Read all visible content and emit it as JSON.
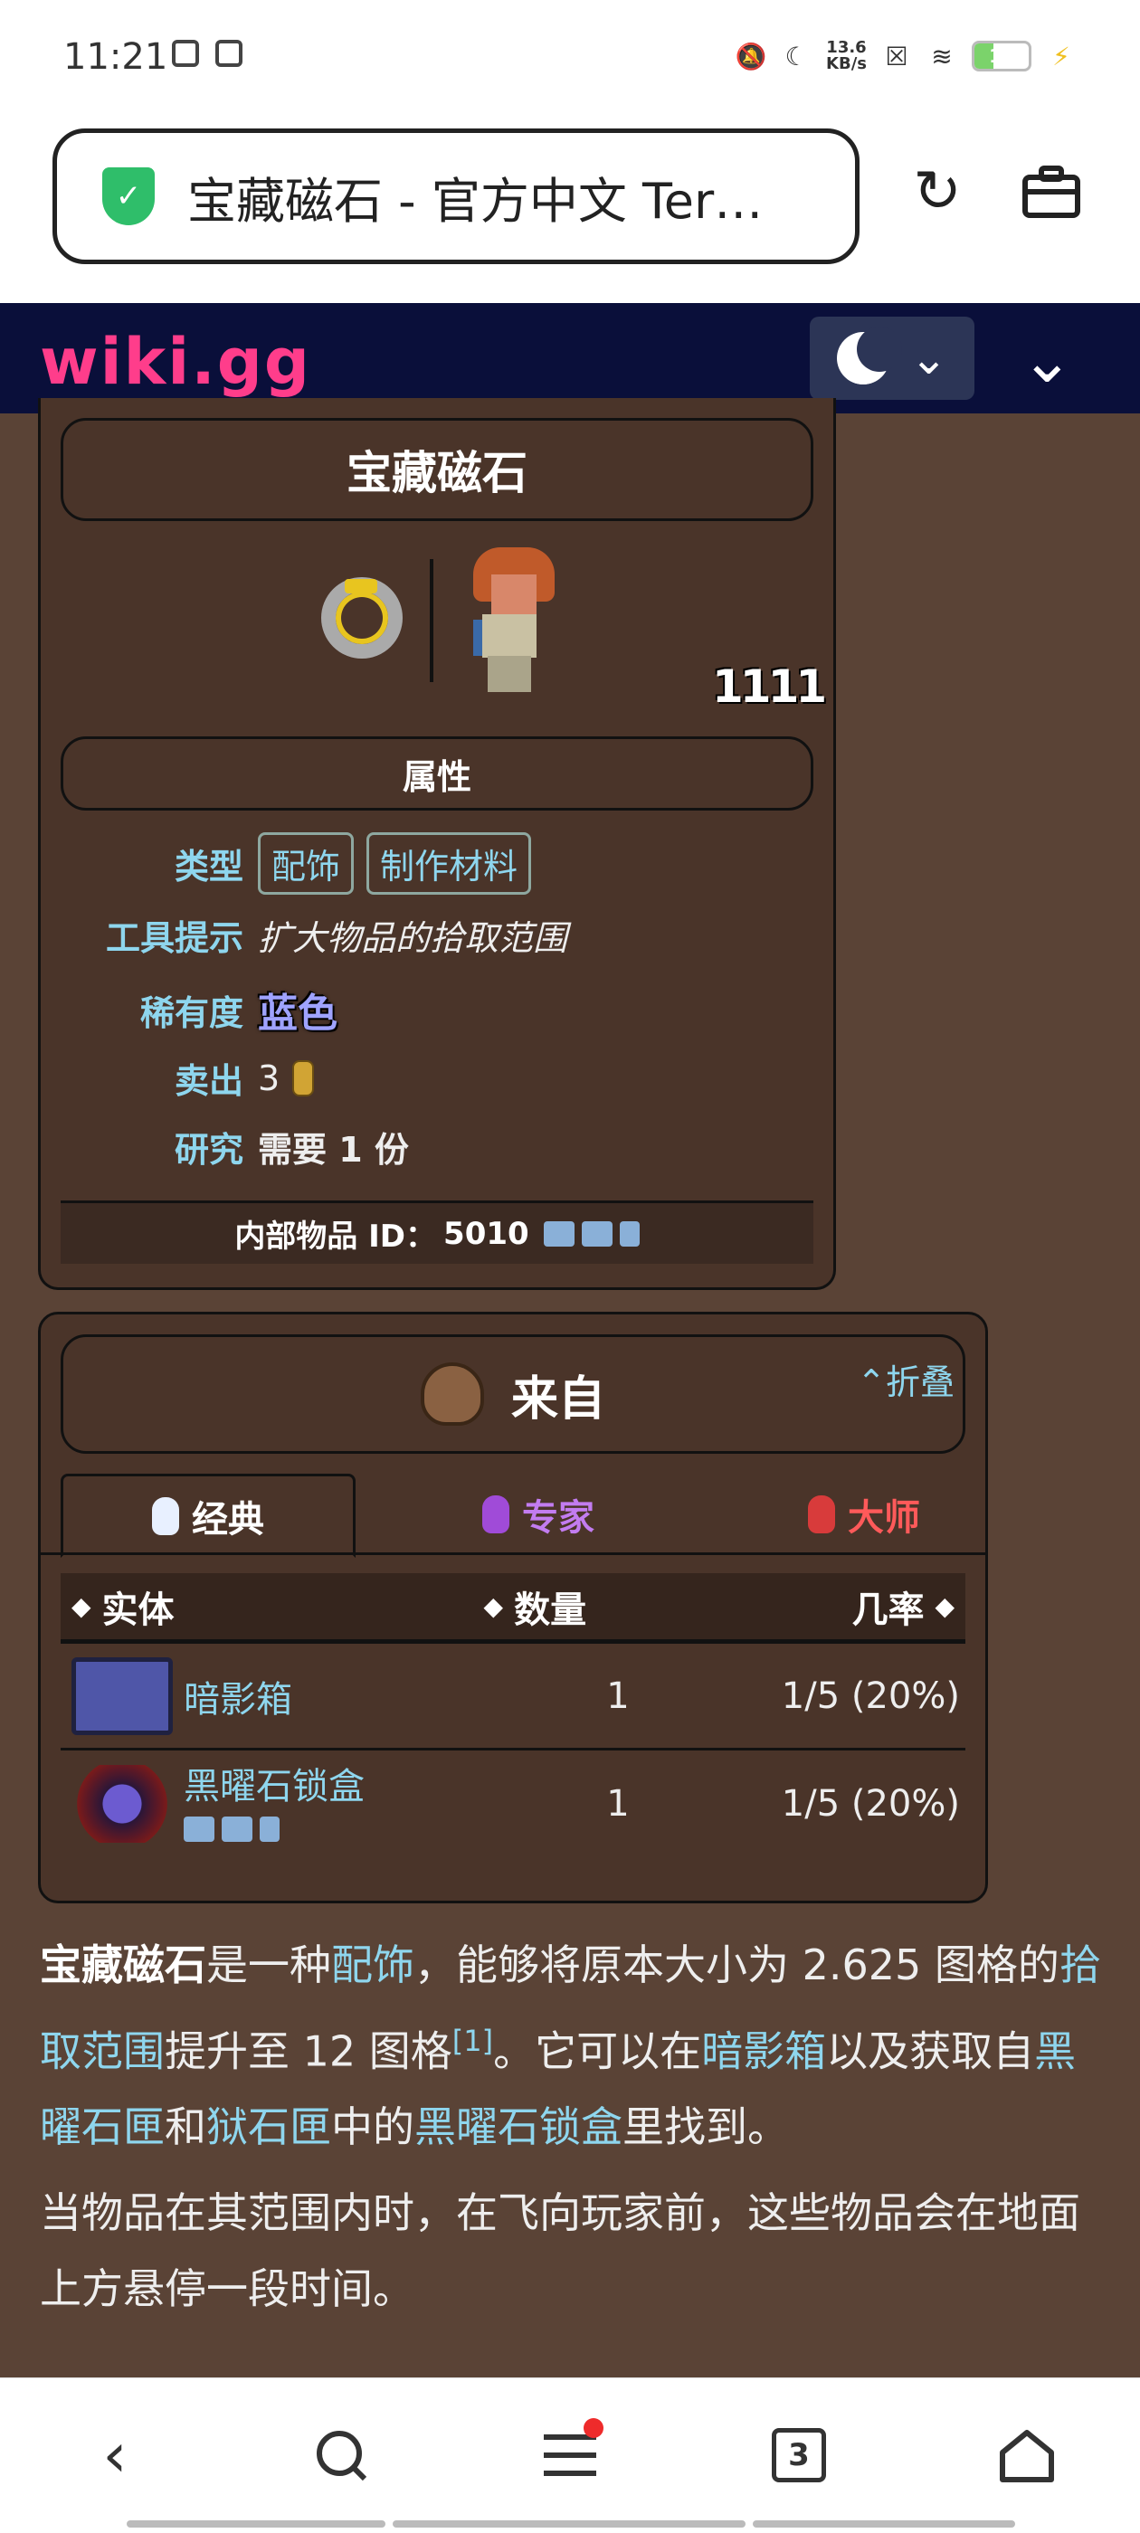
{
  "status": {
    "time": "11:21",
    "speed_top": "13.6",
    "speed_bottom": "KB/s",
    "battery": "17"
  },
  "browser": {
    "url_title": "宝藏磁石 - 官方中文 Ter…",
    "tab_count": "3"
  },
  "wiki": {
    "logo": "wiki.gg"
  },
  "infobox": {
    "title": "宝藏磁石",
    "use_time": "1111",
    "section": "属性",
    "type_label": "类型",
    "types": [
      "配饰",
      "制作材料"
    ],
    "tooltip_label": "工具提示",
    "tooltip": "扩大物品的拾取范围",
    "rarity_label": "稀有度",
    "rarity": "蓝色",
    "rarity_color": "#9fa3ff",
    "sell_label": "卖出",
    "sell": "3",
    "research_label": "研究",
    "research": "需要 1 份",
    "internal_id_label": "内部物品 ID：",
    "internal_id": "5010"
  },
  "drops": {
    "title": "来自",
    "collapse": "折叠",
    "tabs": [
      {
        "label": "经典",
        "color": "#ffffff",
        "icon": "bunny-icon"
      },
      {
        "label": "专家",
        "color": "#c27cf0",
        "icon": "bunny-icon"
      },
      {
        "label": "大师",
        "color": "#ff5a5a",
        "icon": "bunny-icon"
      }
    ],
    "headers": {
      "entity": "实体",
      "quantity": "数量",
      "rate": "几率"
    },
    "rows": [
      {
        "name": "暗影箱",
        "qty": "1",
        "rate": "1/5 (20%)"
      },
      {
        "name": "黑曜石锁盒",
        "qty": "1",
        "rate": "1/5 (20%)"
      }
    ]
  },
  "article": {
    "p1": [
      "宝藏磁石",
      "是一种",
      "配饰",
      "，能够将原本大小为 2.625 图格的",
      "拾取范围",
      "提升至 12 图格",
      "[1]",
      "。它可以在",
      "暗影箱",
      "以及获取自",
      "黑曜石匣",
      "和",
      "狱石匣",
      "中的",
      "黑曜石锁盒",
      "里找到。"
    ],
    "p2": "当物品在其范围内时，在飞向玩家前，这些物品会在地面上方悬停一段时间。"
  }
}
